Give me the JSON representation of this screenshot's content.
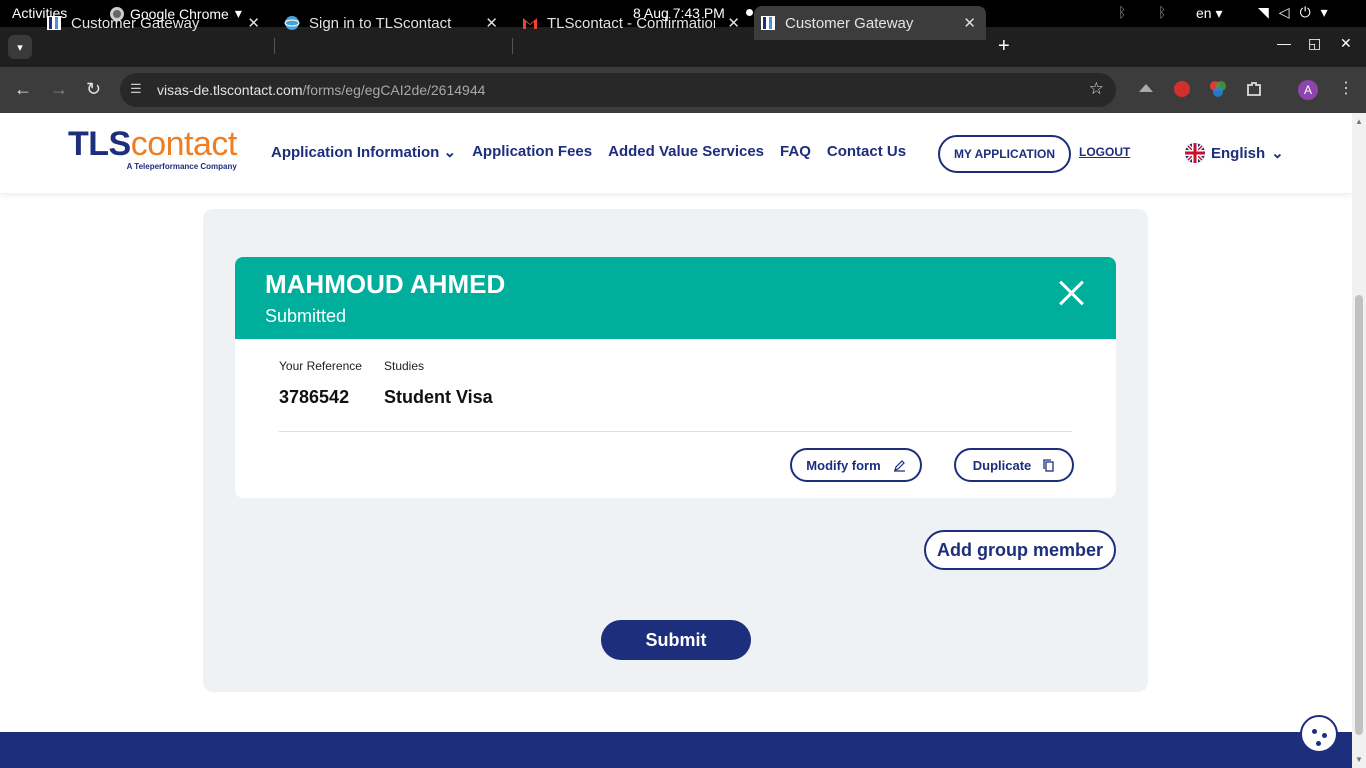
{
  "system": {
    "activities": "Activities",
    "app_name": "Google Chrome",
    "clock": "8 Aug  7:43 PM",
    "lang": "en"
  },
  "tabs": [
    {
      "title": "Customer Gateway"
    },
    {
      "title": "Sign in to TLScontact"
    },
    {
      "title": "TLScontact - Confirmation"
    },
    {
      "title": "Customer Gateway"
    }
  ],
  "address": {
    "domain": "visas-de.tlscontact.com",
    "path": "/forms/eg/egCAI2de/2614944"
  },
  "profile_initial": "A",
  "site": {
    "logo_tls": "TLS",
    "logo_contact": "contact",
    "logo_sub": "A Teleperformance Company",
    "nav": [
      "Application Information",
      "Application Fees",
      "Added Value Services",
      "FAQ",
      "Contact Us"
    ],
    "my_application": "MY APPLICATION",
    "logout": "LOGOUT",
    "language": "English"
  },
  "applicant": {
    "name": "MAHMOUD AHMED",
    "status": "Submitted",
    "reference_label": "Your Reference",
    "reference": "3786542",
    "purpose_label": "Studies",
    "visa_type": "Student Visa",
    "modify_label": "Modify form",
    "duplicate_label": "Duplicate"
  },
  "actions": {
    "add_group_member": "Add group member",
    "submit": "Submit"
  },
  "colors": {
    "brand_navy": "#1c2e7c",
    "brand_orange": "#ef7d22",
    "card_header": "#00ae9c"
  }
}
